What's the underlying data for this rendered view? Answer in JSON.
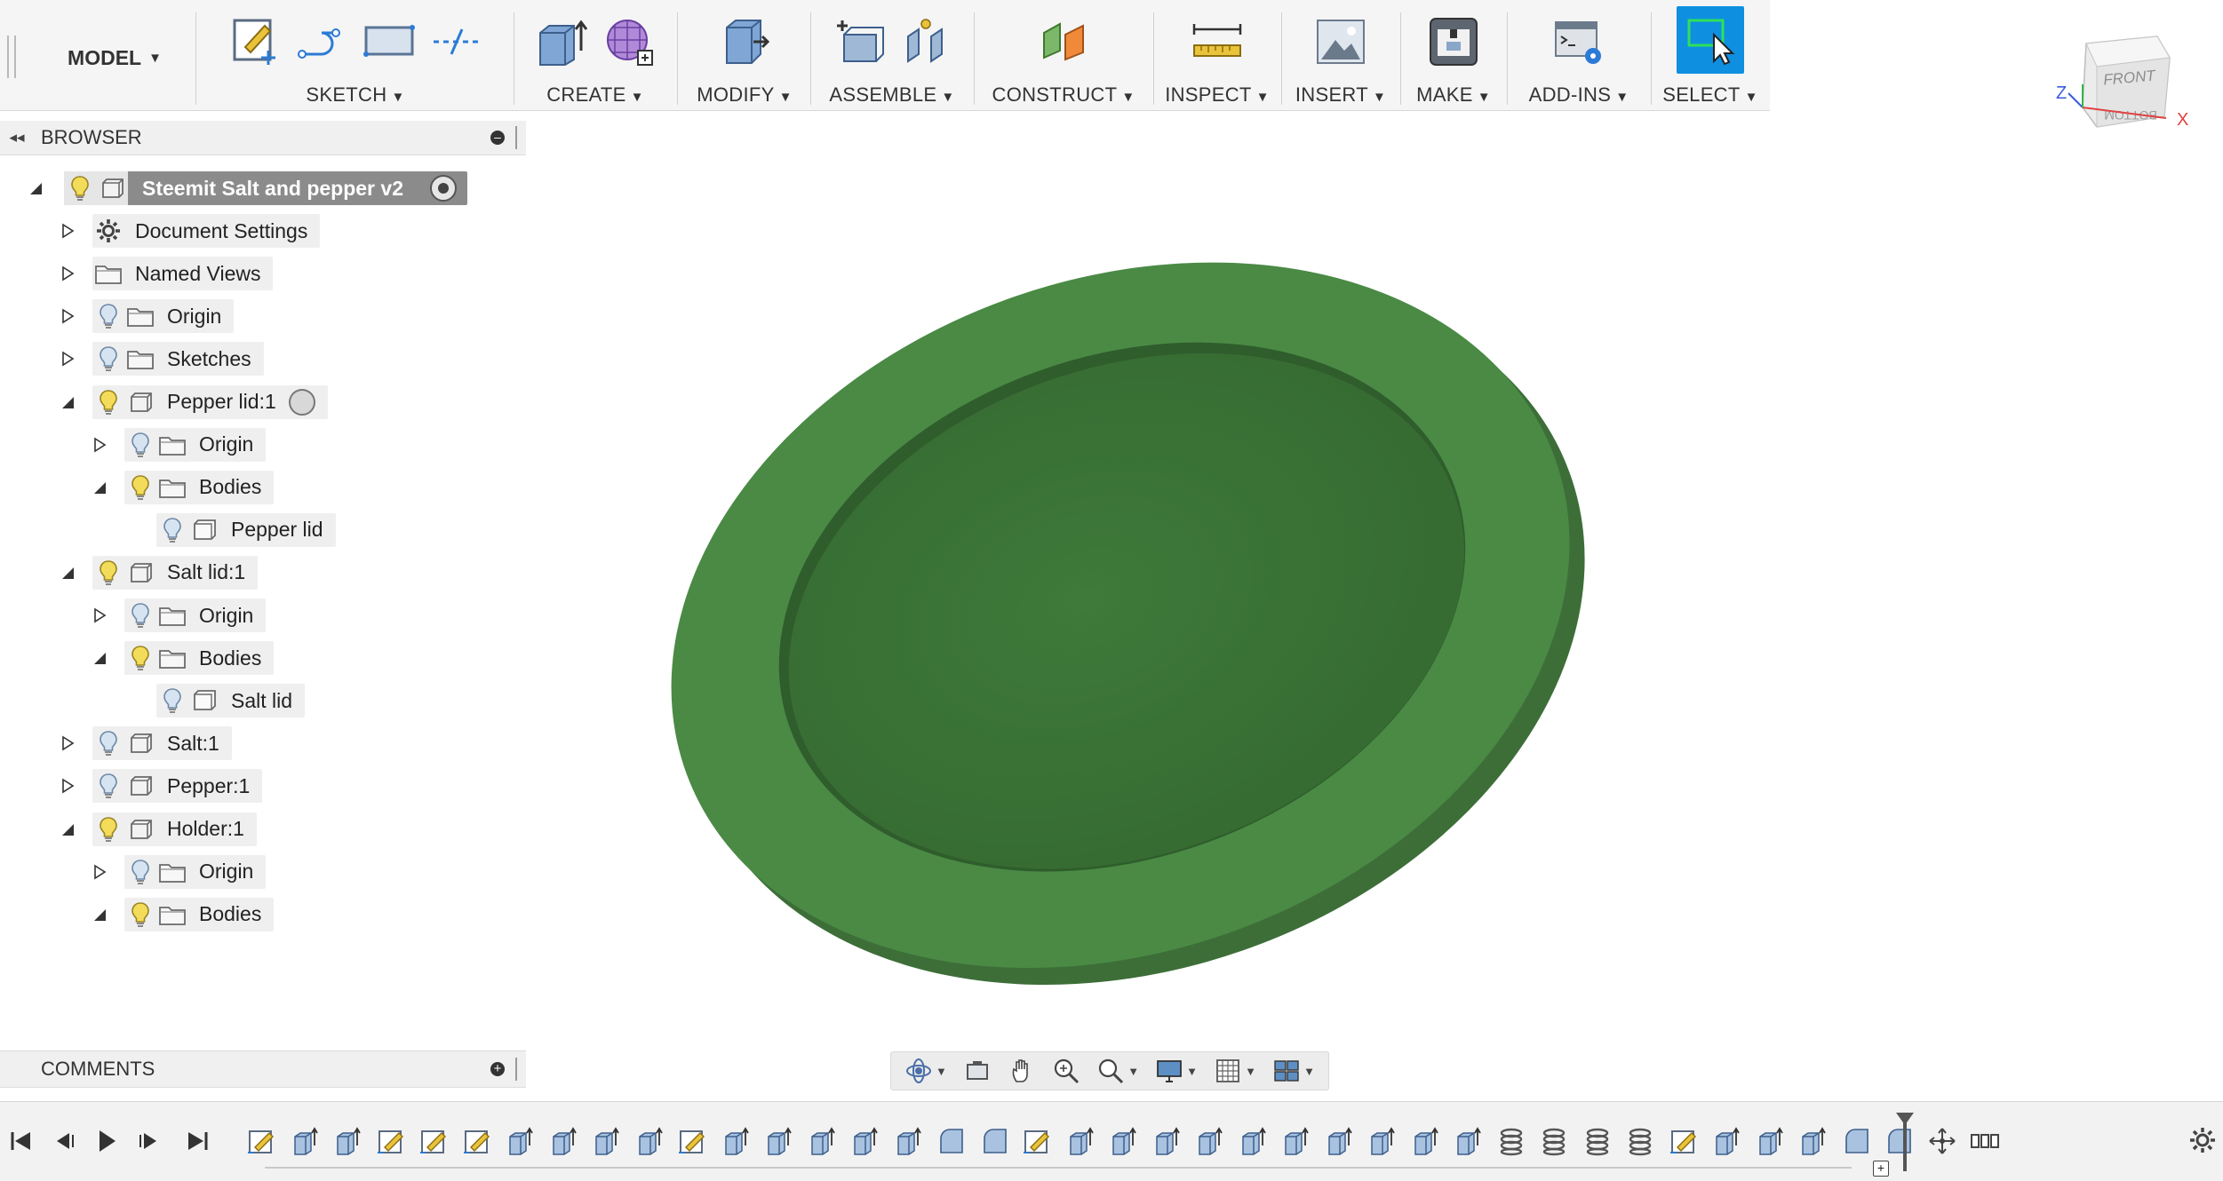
{
  "toolbar": {
    "workspace": "MODEL",
    "groups": [
      {
        "label": "SKETCH"
      },
      {
        "label": "CREATE"
      },
      {
        "label": "MODIFY"
      },
      {
        "label": "ASSEMBLE"
      },
      {
        "label": "CONSTRUCT"
      },
      {
        "label": "INSPECT"
      },
      {
        "label": "INSERT"
      },
      {
        "label": "MAKE"
      },
      {
        "label": "ADD-INS"
      },
      {
        "label": "SELECT"
      }
    ]
  },
  "viewcube": {
    "face_front": "FRONT",
    "face_bottom": "BOTTOM",
    "axis_x": "X",
    "axis_z": "Z"
  },
  "browser": {
    "title": "BROWSER",
    "root": "Steemit Salt and pepper v2",
    "items": [
      "Document Settings",
      "Named Views",
      "Origin",
      "Sketches",
      "Pepper lid:1",
      "Origin",
      "Bodies",
      "Pepper lid",
      "Salt lid:1",
      "Origin",
      "Bodies",
      "Salt lid",
      "Salt:1",
      "Pepper:1",
      "Holder:1",
      "Origin",
      "Bodies"
    ]
  },
  "comments": {
    "title": "COMMENTS"
  },
  "colors": {
    "accent": "#0f8fe0",
    "model_green": "#4a8a45",
    "model_green_dark": "#3a6e35",
    "bulb": "#e8cf4a"
  }
}
